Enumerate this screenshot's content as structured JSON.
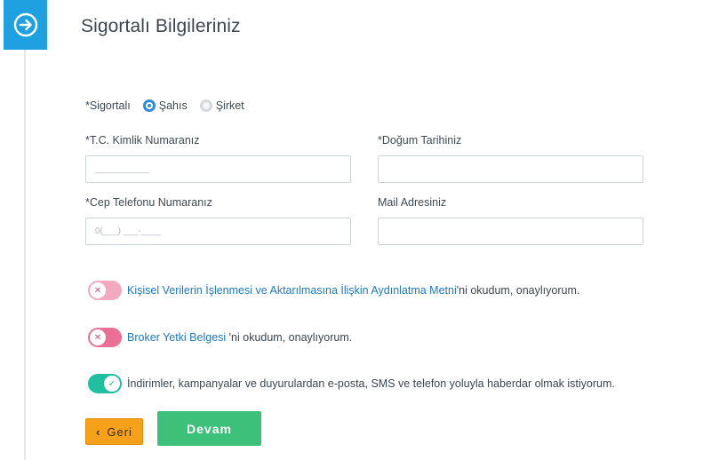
{
  "header": {
    "title": "Sigortalı Bilgileriniz"
  },
  "insured": {
    "label": "*Sigortalı",
    "options": [
      {
        "label": "Şahıs",
        "selected": true
      },
      {
        "label": "Şirket",
        "selected": false
      }
    ]
  },
  "fields": {
    "tc": {
      "label": "*T.C. Kimlik Numaranız",
      "placeholder": "___________"
    },
    "birth": {
      "label": "*Doğum Tarihiniz",
      "placeholder": ""
    },
    "phone": {
      "label": "*Cep Telefonu Numaranız",
      "placeholder": "0(___) ___-____"
    },
    "mail": {
      "label": "Mail Adresiniz",
      "placeholder": ""
    }
  },
  "consents": [
    {
      "state": "off",
      "link": "Kişisel Verilerin İşlenmesi ve Aktarılmasına İlişkin Aydınlatma Metni",
      "text": "'ni okudum, onaylıyorum."
    },
    {
      "state": "off",
      "link": "Broker Yetki Belgesi",
      "text": " 'ni okudum, onaylıyorum."
    },
    {
      "state": "on",
      "link": "",
      "text": "İndirimler, kampanyalar ve duyurulardan e-posta, SMS ve telefon yoluyla haberdar olmak istiyorum."
    }
  ],
  "buttons": {
    "back": "Geri",
    "next": "Devam"
  },
  "colors": {
    "accent": "#1fa0e0",
    "toggle_on": "#1ec0a0",
    "toggle_off": "#ec6f95",
    "back_button": "#f7a11b",
    "next_button": "#3dc07a"
  }
}
